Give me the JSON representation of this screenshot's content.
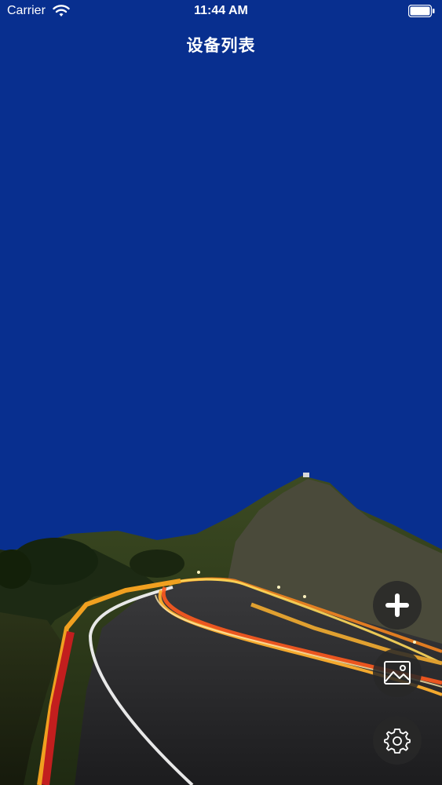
{
  "status_bar": {
    "carrier": "Carrier",
    "time": "11:44 AM",
    "wifi_icon": "wifi-icon",
    "battery_icon": "battery-icon"
  },
  "header": {
    "title": "设备列表"
  },
  "background": {
    "sky_color": "#082f8f",
    "scene": "mountain-road-light-trails-image"
  },
  "actions": {
    "add_icon": "plus-icon",
    "gallery_icon": "image-icon",
    "settings_icon": "gear-icon"
  }
}
